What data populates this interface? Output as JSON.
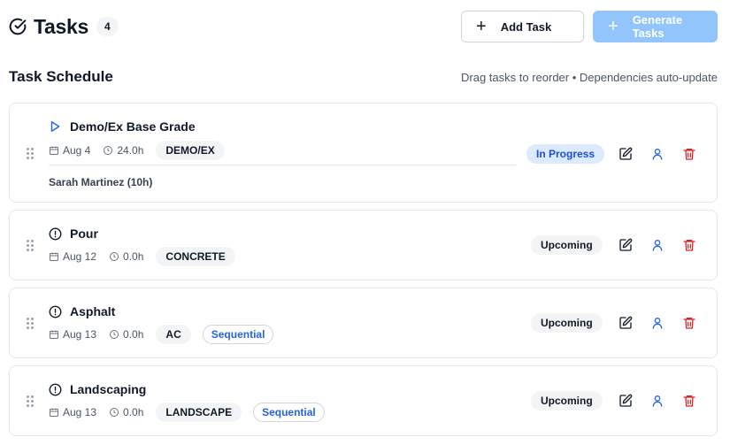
{
  "header": {
    "title": "Tasks",
    "count": "4",
    "add_task_label": "Add Task",
    "generate_tasks_label": "Generate Tasks"
  },
  "section": {
    "title": "Task Schedule",
    "hint": "Drag tasks to reorder • Dependencies auto-update"
  },
  "tasks": [
    {
      "title": "Demo/Ex Base Grade",
      "icon": "play-icon",
      "date": "Aug 4",
      "hours": "24.0h",
      "trade": "DEMO/EX",
      "sequential": "",
      "assignee": "Sarah Martinez (10h)",
      "status": "In Progress"
    },
    {
      "title": "Pour",
      "icon": "alert-circle-icon",
      "date": "Aug 12",
      "hours": "0.0h",
      "trade": "CONCRETE",
      "sequential": "",
      "status": "Upcoming"
    },
    {
      "title": "Asphalt",
      "icon": "alert-circle-icon",
      "date": "Aug 13",
      "hours": "0.0h",
      "trade": "AC",
      "sequential": "Sequential",
      "status": "Upcoming"
    },
    {
      "title": "Landscaping",
      "icon": "alert-circle-icon",
      "date": "Aug 13",
      "hours": "0.0h",
      "trade": "LANDSCAPE",
      "sequential": "Sequential",
      "status": "Upcoming"
    }
  ],
  "colors": {
    "primary_disabled": "#93c5fd",
    "in_progress_bg": "#dbeafe",
    "in_progress_text": "#1d4ed8",
    "assign_icon": "#2563eb",
    "delete_icon": "#dc2626"
  }
}
